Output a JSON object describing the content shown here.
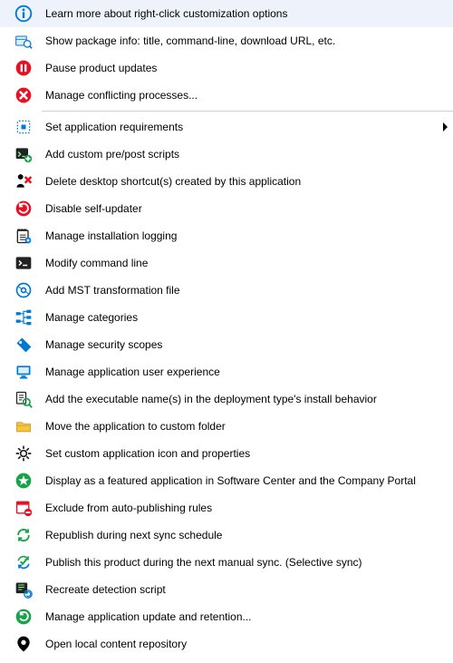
{
  "menu": {
    "items": [
      {
        "id": "learn-more",
        "label": "Learn more about right-click customization options",
        "submenu": false
      },
      {
        "id": "show-package-info",
        "label": "Show package info: title, command-line, download URL, etc.",
        "submenu": false
      },
      {
        "id": "pause-updates",
        "label": "Pause product updates",
        "submenu": false
      },
      {
        "id": "manage-conflicting",
        "label": "Manage conflicting processes...",
        "submenu": false
      },
      {
        "sep": true
      },
      {
        "id": "set-requirements",
        "label": "Set application requirements",
        "submenu": true
      },
      {
        "id": "add-scripts",
        "label": "Add custom pre/post scripts",
        "submenu": false
      },
      {
        "id": "delete-shortcuts",
        "label": "Delete desktop shortcut(s) created by this application",
        "submenu": false
      },
      {
        "id": "disable-self-updater",
        "label": "Disable self-updater",
        "submenu": false
      },
      {
        "id": "manage-logging",
        "label": "Manage installation logging",
        "submenu": false
      },
      {
        "id": "modify-cmdline",
        "label": "Modify command line",
        "submenu": false
      },
      {
        "id": "add-mst",
        "label": "Add MST transformation file",
        "submenu": false
      },
      {
        "id": "manage-categories",
        "label": "Manage categories",
        "submenu": false
      },
      {
        "id": "manage-scopes",
        "label": "Manage security scopes",
        "submenu": false
      },
      {
        "id": "manage-ux",
        "label": "Manage application user experience",
        "submenu": false
      },
      {
        "id": "add-exe-names",
        "label": "Add the executable name(s) in the deployment type's install behavior",
        "submenu": false
      },
      {
        "id": "move-folder",
        "label": "Move the application to custom folder",
        "submenu": false
      },
      {
        "id": "set-icon",
        "label": "Set custom application icon and properties",
        "submenu": false
      },
      {
        "id": "display-featured",
        "label": "Display as a featured application in Software Center and the Company Portal",
        "submenu": false
      },
      {
        "id": "exclude-auto",
        "label": "Exclude from auto-publishing rules",
        "submenu": false
      },
      {
        "id": "republish-sync",
        "label": "Republish during next sync schedule",
        "submenu": false
      },
      {
        "id": "publish-selective",
        "label": "Publish this product during the next manual sync. (Selective sync)",
        "submenu": false
      },
      {
        "id": "recreate-detection",
        "label": "Recreate detection script",
        "submenu": false
      },
      {
        "id": "manage-update-retention",
        "label": "Manage application update and retention...",
        "submenu": false
      },
      {
        "id": "open-local-repo",
        "label": "Open local content repository",
        "submenu": false
      }
    ]
  }
}
